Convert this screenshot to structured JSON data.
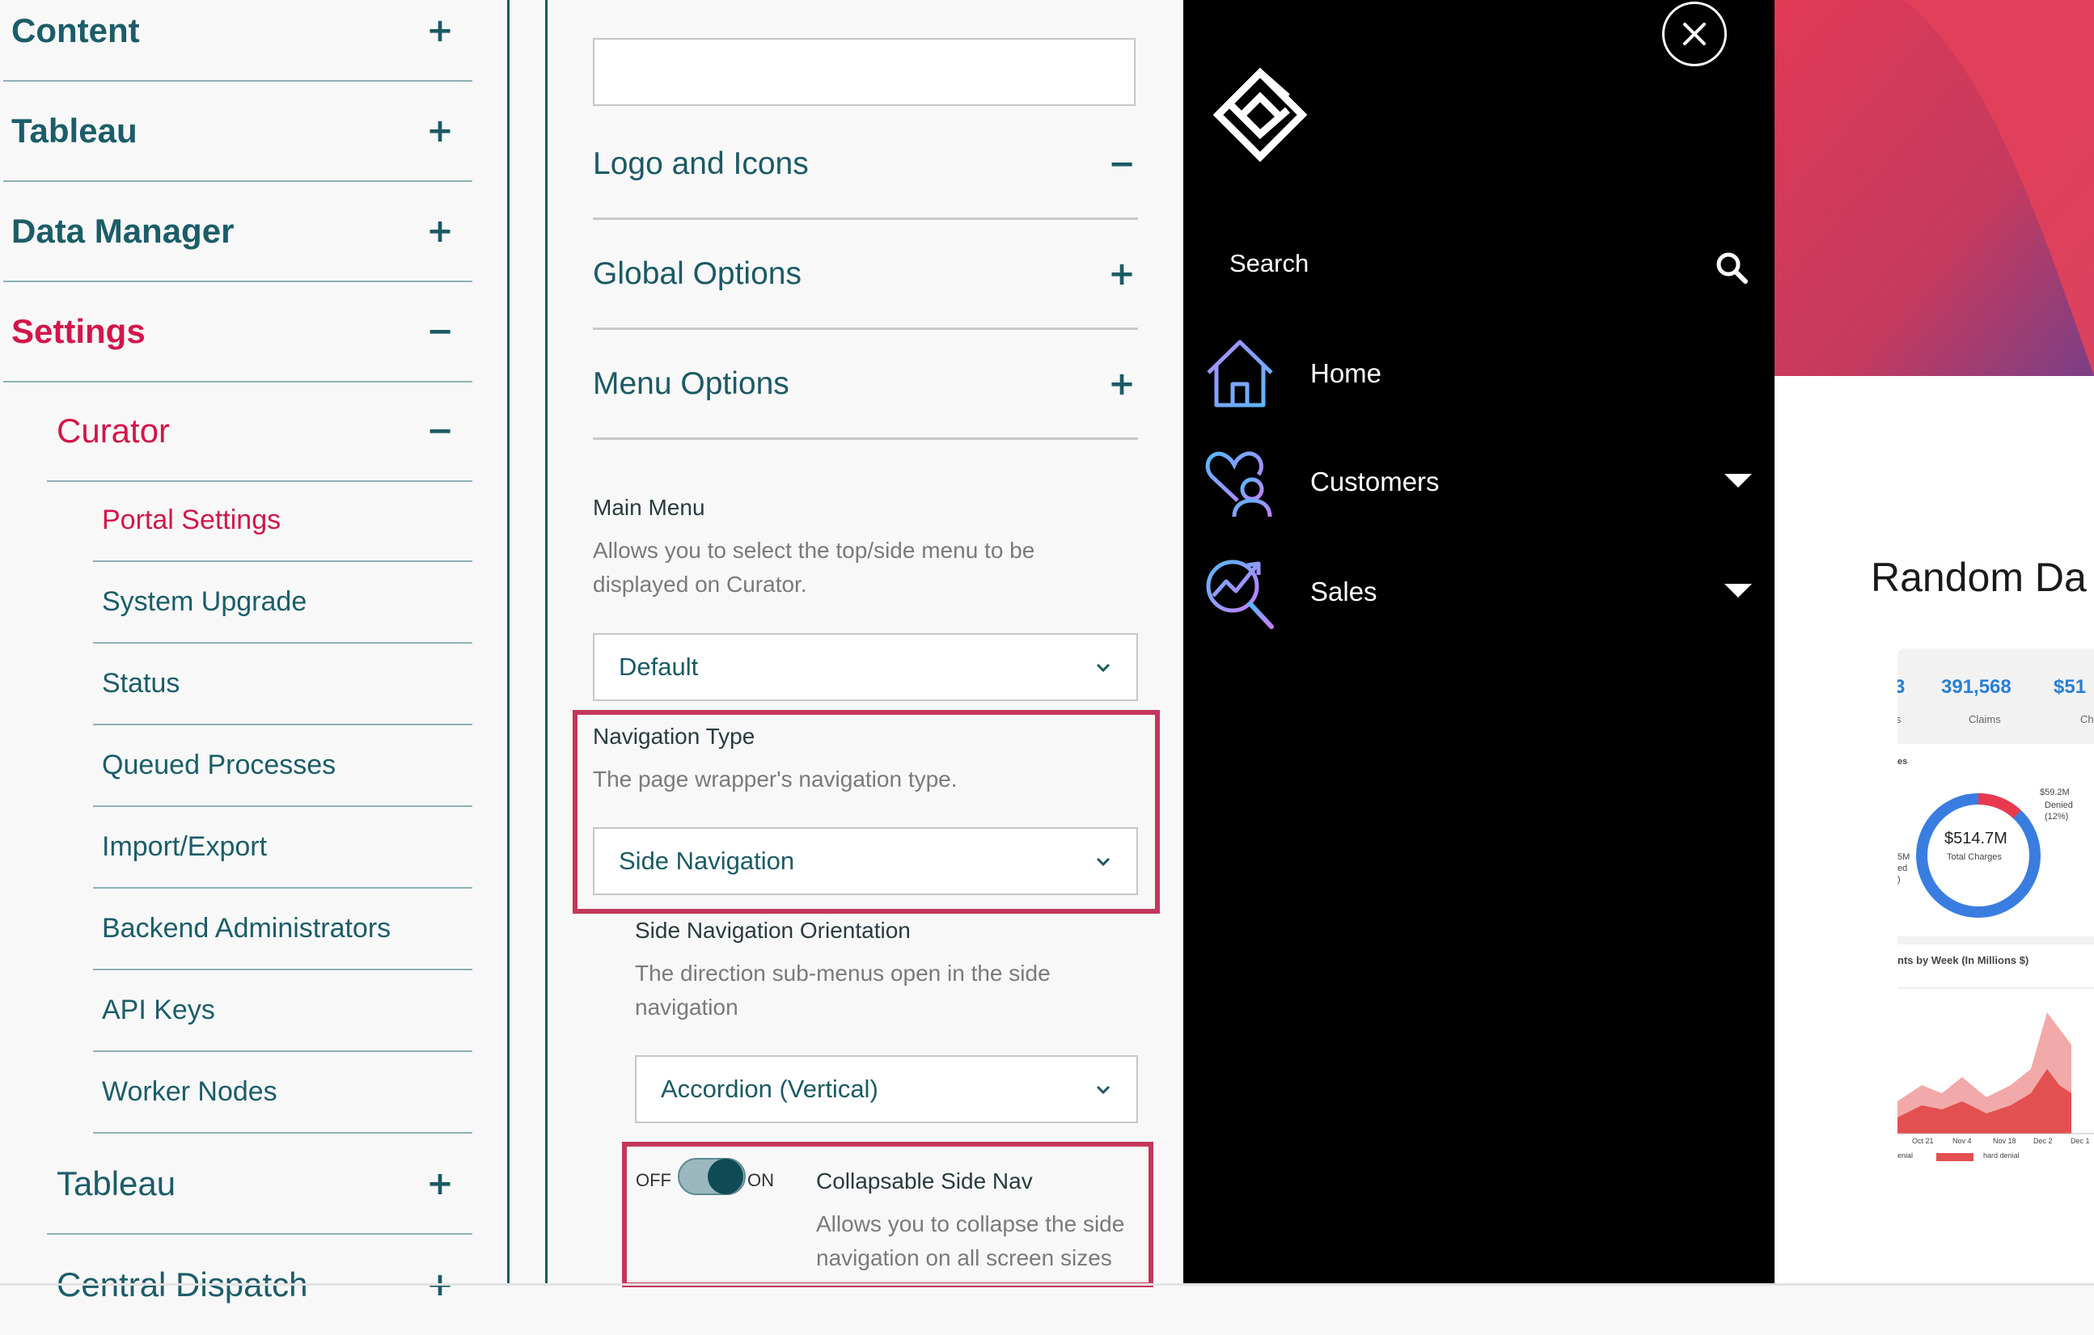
{
  "sidebar": {
    "items": [
      {
        "label": "Content",
        "sign": "+"
      },
      {
        "label": "Tableau",
        "sign": "+"
      },
      {
        "label": "Data Manager",
        "sign": "+"
      },
      {
        "label": "Settings",
        "sign": "−"
      }
    ],
    "curator": {
      "label": "Curator",
      "sign": "−"
    },
    "curator_children": [
      "Portal Settings",
      "System Upgrade",
      "Status",
      "Queued Processes",
      "Import/Export",
      "Backend Administrators",
      "API Keys",
      "Worker Nodes"
    ],
    "tableau_sub": {
      "label": "Tableau",
      "sign": "+"
    },
    "central_dispatch": {
      "label": "Central Dispatch",
      "sign": "+"
    }
  },
  "settings_panel": {
    "sections": [
      {
        "label": "Logo and Icons",
        "sign": "−"
      },
      {
        "label": "Global Options",
        "sign": "+"
      },
      {
        "label": "Menu Options",
        "sign": "+"
      }
    ],
    "main_menu": {
      "label": "Main Menu",
      "description": "Allows you to select the top/side menu to be displayed on Curator.",
      "value": "Default"
    },
    "navigation_type": {
      "label": "Navigation Type",
      "description": "The page wrapper's navigation type.",
      "value": "Side Navigation"
    },
    "side_nav_orientation": {
      "label": "Side Navigation Orientation",
      "description": "The direction sub-menus open in the side navigation",
      "value": "Accordion (Vertical)"
    },
    "collapsable": {
      "off_label": "OFF",
      "on_label": "ON",
      "state": true,
      "label": "Collapsable Side Nav",
      "description": "Allows you to collapse the side navigation on all screen sizes"
    },
    "highlight_color": "#c4375a"
  },
  "preview_nav": {
    "search_label": "Search",
    "items": [
      {
        "label": "Home",
        "icon": "home-icon",
        "has_submenu": false
      },
      {
        "label": "Customers",
        "icon": "customers-icon",
        "has_submenu": true
      },
      {
        "label": "Sales",
        "icon": "sales-analytics-icon",
        "has_submenu": true
      }
    ]
  },
  "dashboard_preview": {
    "title": "Random Da",
    "kpis": [
      {
        "value": "3",
        "label": "s"
      },
      {
        "value": "391,568",
        "label": "Claims"
      },
      {
        "value": "$51",
        "label": "Ch"
      }
    ],
    "donut_section": "es",
    "donut": {
      "center_value": "$514.7M",
      "center_label": "Total Charges",
      "denied_value": "$59.2M",
      "denied_label": "Denied",
      "denied_pct": "(12%)",
      "left_labels": [
        "5M",
        "ed",
        ")"
      ],
      "denied_fraction": 0.12
    },
    "trend_title": "nts by Week (In Millions $)",
    "trend_x_labels": [
      "Oct 21",
      "Nov 4",
      "Nov 18",
      "Dec 2",
      "Dec 1"
    ],
    "trend_legend": [
      "enial",
      "hard denial"
    ]
  }
}
